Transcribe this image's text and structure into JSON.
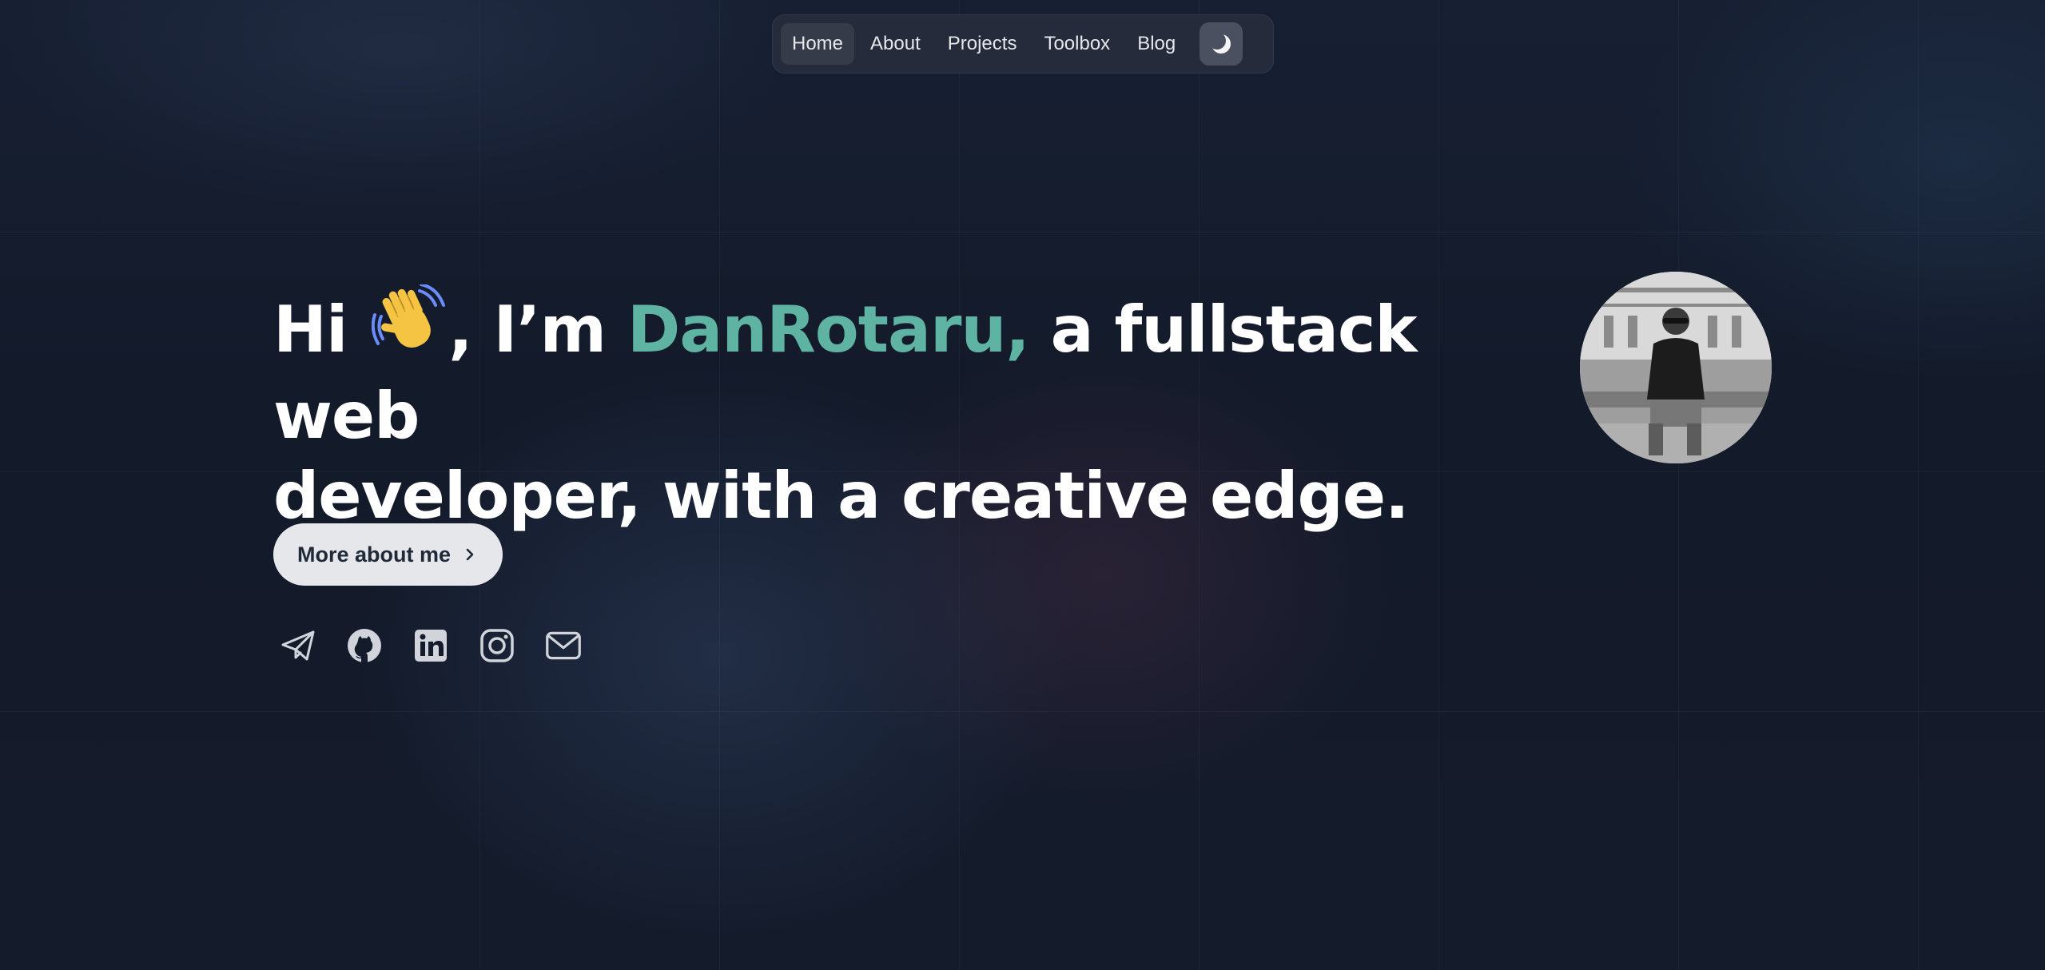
{
  "nav": {
    "items": [
      {
        "label": "Home",
        "active": true
      },
      {
        "label": "About",
        "active": false
      },
      {
        "label": "Projects",
        "active": false
      },
      {
        "label": "Toolbox",
        "active": false
      },
      {
        "label": "Blog",
        "active": false
      }
    ],
    "theme_icon": "moon-icon"
  },
  "hero": {
    "greeting": "Hi",
    "wave_icon": "waving-hand-icon",
    "intro": ", I’m",
    "name": "DanRotaru,",
    "tagline_line1": "a fullstack web",
    "tagline_line2": "developer, with a creative edge.",
    "name_color": "#5fb3a3"
  },
  "avatar": {
    "icon": "profile-photo"
  },
  "cta": {
    "label": "More about me",
    "icon": "chevron-right-icon"
  },
  "socials": [
    {
      "icon": "telegram-icon"
    },
    {
      "icon": "github-icon"
    },
    {
      "icon": "linkedin-icon"
    },
    {
      "icon": "instagram-icon"
    },
    {
      "icon": "mail-icon"
    }
  ]
}
